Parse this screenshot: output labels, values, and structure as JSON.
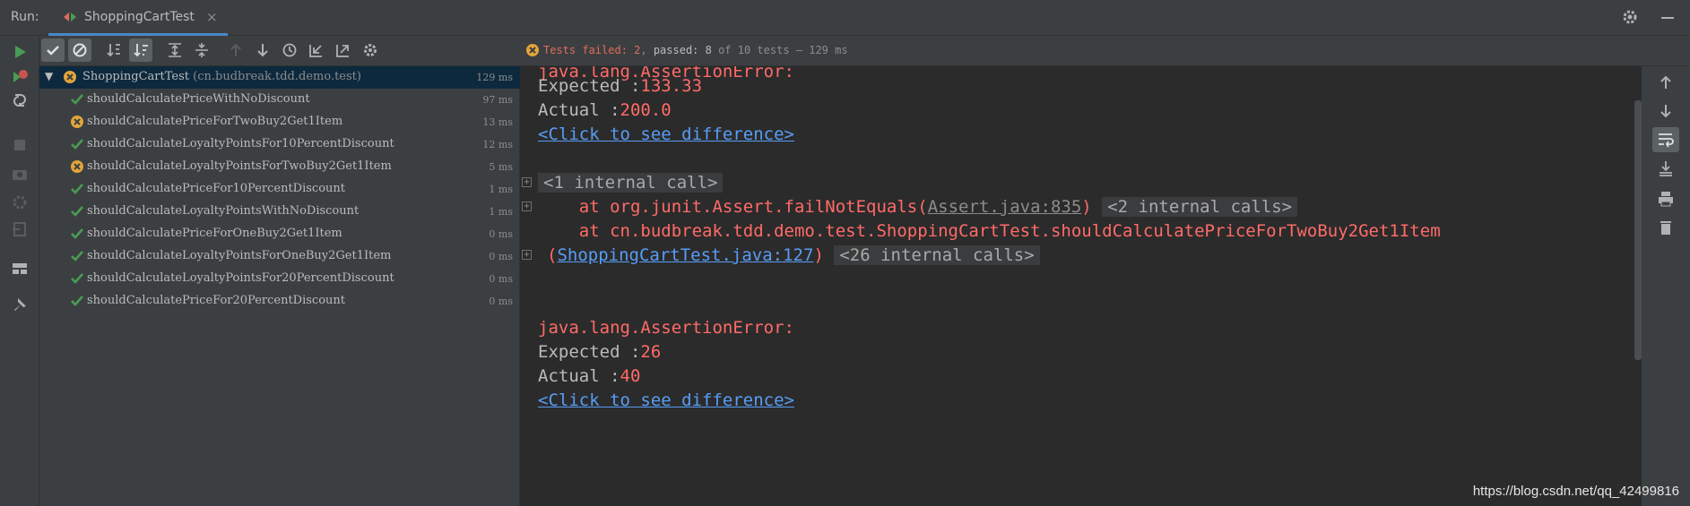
{
  "colors": {
    "accent": "#4a88c7",
    "pass": "#499c54",
    "fail": "#e2a53a",
    "error_text": "#ff6b68",
    "link": "#589df6"
  },
  "header": {
    "run_label": "Run:",
    "tab": {
      "title": "ShoppingCartTest",
      "close": "×",
      "icon": "run-config-icon"
    }
  },
  "status": {
    "tests_failed": "Tests failed: 2",
    "separator": ", ",
    "passed": "passed: 8",
    "of_total": " of 10 tests",
    "duration": " – 129 ms"
  },
  "tree": {
    "root": {
      "name": "ShoppingCartTest",
      "package": "(cn.budbreak.tdd.demo.test)",
      "time": "129 ms",
      "status": "failed"
    },
    "tests": [
      {
        "name": "shouldCalculatePriceWithNoDiscount",
        "time": "97 ms",
        "status": "passed"
      },
      {
        "name": "shouldCalculatePriceForTwoBuy2Get1Item",
        "time": "13 ms",
        "status": "failed"
      },
      {
        "name": "shouldCalculateLoyaltyPointsFor10PercentDiscount",
        "time": "12 ms",
        "status": "passed"
      },
      {
        "name": "shouldCalculateLoyaltyPointsForTwoBuy2Get1Item",
        "time": "5 ms",
        "status": "failed"
      },
      {
        "name": "shouldCalculatePriceFor10PercentDiscount",
        "time": "1 ms",
        "status": "passed"
      },
      {
        "name": "shouldCalculateLoyaltyPointsWithNoDiscount",
        "time": "1 ms",
        "status": "passed"
      },
      {
        "name": "shouldCalculatePriceForOneBuy2Get1Item",
        "time": "0 ms",
        "status": "passed"
      },
      {
        "name": "shouldCalculateLoyaltyPointsForOneBuy2Get1Item",
        "time": "0 ms",
        "status": "passed"
      },
      {
        "name": "shouldCalculateLoyaltyPointsFor20PercentDiscount",
        "time": "0 ms",
        "status": "passed"
      },
      {
        "name": "shouldCalculatePriceFor20PercentDiscount",
        "time": "0 ms",
        "status": "passed"
      }
    ]
  },
  "console": {
    "error1": "java.lang.AssertionError:",
    "expected_label": "Expected :",
    "expected1": "133.33",
    "actual_label": "Actual   :",
    "actual1": "200.0",
    "diff_link": "<Click to see difference>",
    "internal_call": "<1 internal call>",
    "at1_prefix": "    at org.junit.Assert.failNotEquals(",
    "at1_link": "Assert.java:835",
    "at1_suffix": ")",
    "internal_calls_2": "<2 internal calls>",
    "at2": "    at cn.budbreak.tdd.demo.test.ShoppingCartTest.shouldCalculatePriceForTwoBuy2Get1Item",
    "at3_open": "(",
    "at3_link": "ShoppingCartTest.java:127",
    "at3_close": ")",
    "internal_calls_26": "<26 internal calls>",
    "error2": "java.lang.AssertionError:",
    "expected2": "26",
    "actual2": "40",
    "diff_link2": "<Click to see difference>"
  },
  "watermark": "https://blog.csdn.net/qq_42499816",
  "icons": {
    "toolbar": [
      "show-passed-icon",
      "show-ignored-icon",
      "sort-alpha-icon",
      "sort-duration-icon",
      "expand-all-icon",
      "collapse-all-icon",
      "prev-failed-icon",
      "next-failed-icon",
      "history-icon",
      "import-icon",
      "export-icon",
      "settings-icon"
    ],
    "left": [
      "run-icon",
      "rerun-failed-icon",
      "toggle-auto-test-icon",
      "stop-icon",
      "camera-icon",
      "debug-icon",
      "exit-icon",
      "layout-icon",
      "pin-icon"
    ],
    "right": [
      "up-arrow-icon",
      "down-arrow-icon",
      "soft-wrap-icon",
      "scroll-to-end-icon",
      "print-icon",
      "trash-icon"
    ]
  }
}
